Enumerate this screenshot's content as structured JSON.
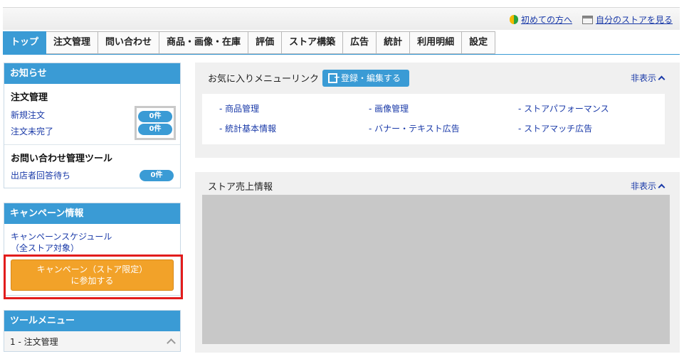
{
  "header": {
    "links": [
      {
        "icon": "beginner-leaf-icon",
        "label": "初めての方へ"
      },
      {
        "icon": "store-view-icon",
        "label": "自分のストアを見る"
      }
    ]
  },
  "tabs": [
    {
      "label": "トップ",
      "active": true
    },
    {
      "label": "注文管理"
    },
    {
      "label": "問い合わせ"
    },
    {
      "label": "商品・画像・在庫"
    },
    {
      "label": "評価"
    },
    {
      "label": "ストア構築"
    },
    {
      "label": "広告"
    },
    {
      "label": "統計"
    },
    {
      "label": "利用明細"
    },
    {
      "label": "設定"
    }
  ],
  "notices": {
    "title": "お知らせ",
    "order_section": {
      "title": "注文管理",
      "items": [
        {
          "label": "新規注文",
          "count": "0件"
        },
        {
          "label": "注文未完了",
          "count": "0件"
        }
      ]
    },
    "inquiry_section": {
      "title": "お問い合わせ管理ツール",
      "items": [
        {
          "label": "出店者回答待ち",
          "count": "0件"
        }
      ]
    }
  },
  "campaign": {
    "title": "キャンペーン情報",
    "schedule_link_line1": "キャンペーンスケジュール",
    "schedule_link_line2": "（全ストア対象）",
    "join_button_line1": "キャンペーン（ストア限定）",
    "join_button_line2": "に参加する"
  },
  "tool_menu": {
    "title": "ツールメニュー",
    "first_item": "1 - 注文管理"
  },
  "favorites": {
    "title": "お気に入りメニューリンク",
    "edit_button": "登録・編集する",
    "hide_label": "非表示",
    "links": [
      "- 商品管理",
      "- 画像管理",
      "- ストアパフォーマンス",
      "- 統計基本情報",
      "- バナー・テキスト広告",
      "- ストアマッチ広告"
    ]
  },
  "sales": {
    "title": "ストア売上情報",
    "hide_label": "非表示"
  },
  "colors": {
    "accent": "#3a9bd5",
    "campaign_button": "#f2a229",
    "highlight_border": "#e21c1c",
    "chart_placeholder": "#c8c8c8"
  }
}
